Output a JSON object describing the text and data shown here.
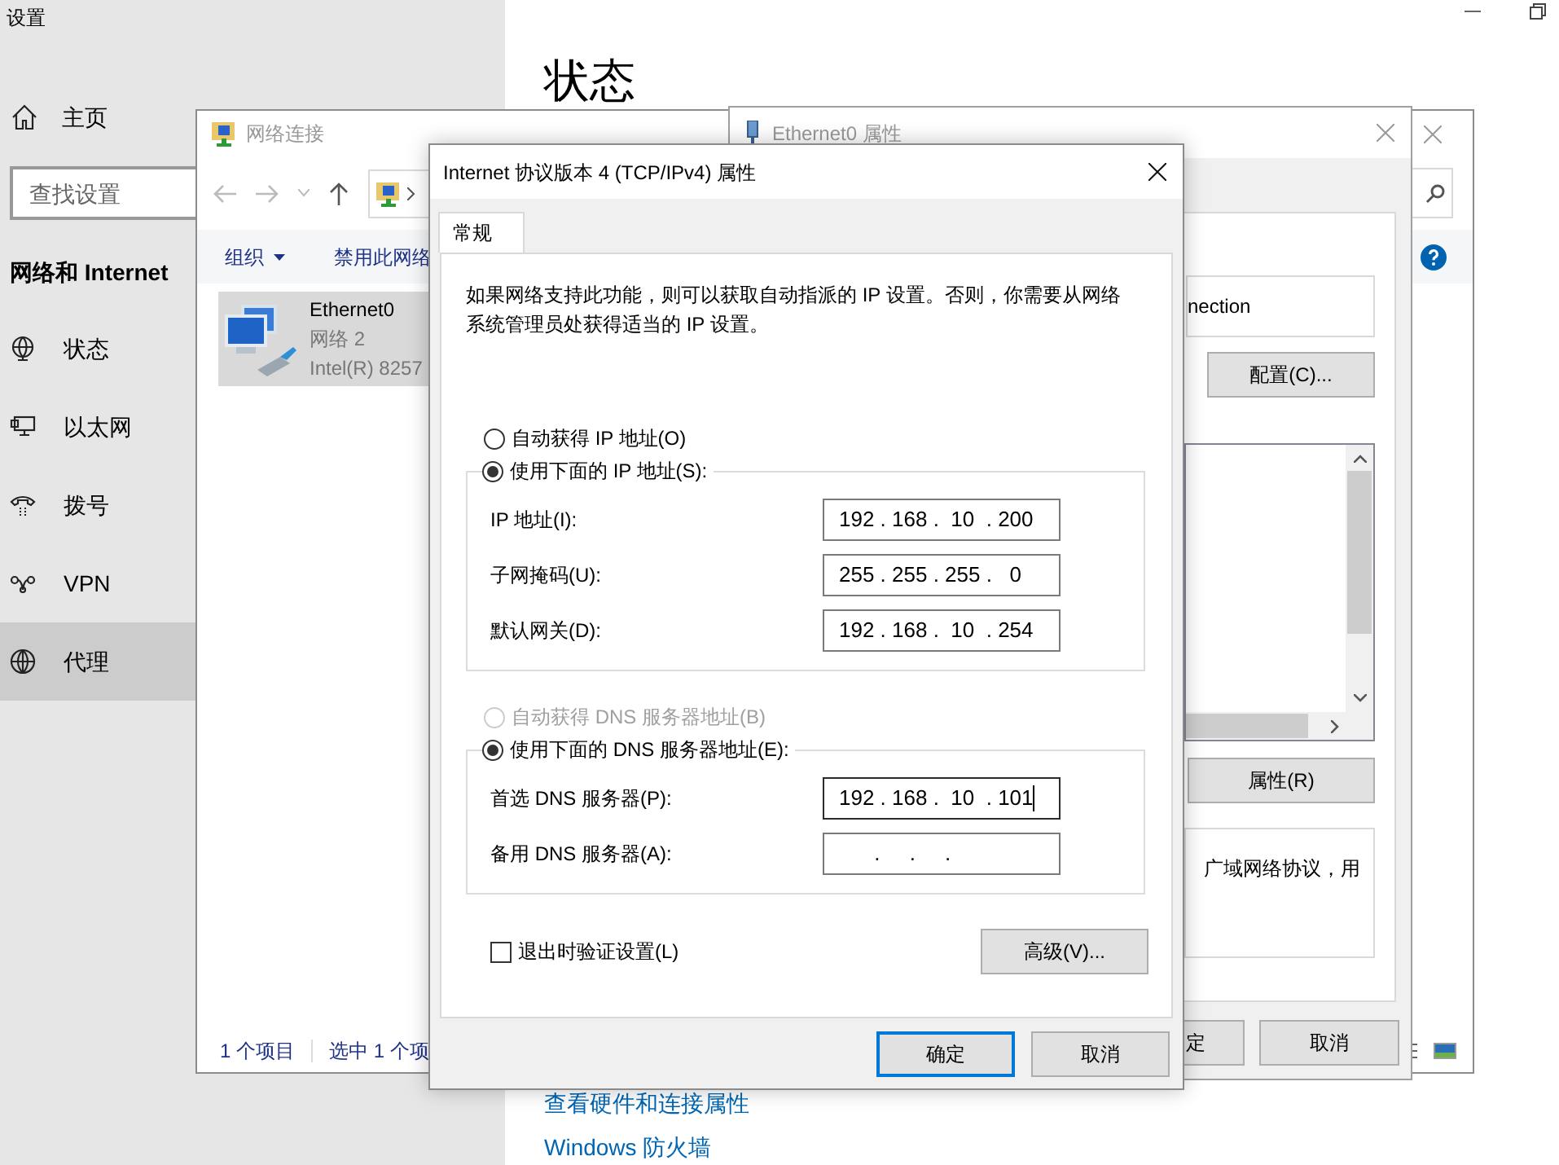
{
  "settings": {
    "title": "设置",
    "heading": "状态",
    "sidebar": {
      "home": "主页",
      "search_placeholder": "查找设置",
      "section": "网络和 Internet",
      "items": [
        {
          "label": "状态",
          "selected": false
        },
        {
          "label": "以太网",
          "selected": false
        },
        {
          "label": "拨号",
          "selected": false
        },
        {
          "label": "VPN",
          "selected": false
        },
        {
          "label": "代理",
          "selected": true
        }
      ]
    },
    "links": [
      "查看硬件和连接属性",
      "Windows 防火墙"
    ]
  },
  "network_window": {
    "title": "网络连接",
    "commands": [
      {
        "label": "组织",
        "dropdown": true
      },
      {
        "label": "禁用此网络",
        "dropdown": false
      }
    ],
    "item": {
      "name": "Ethernet0",
      "network": "网络 2",
      "device": "Intel(R) 8257",
      "selected": true
    },
    "status": [
      "1 个项目",
      "选中 1 个项"
    ]
  },
  "ethernet_window": {
    "title": "Ethernet0 属性",
    "adapter_text": "nection",
    "configure_button": "配置(C)...",
    "properties_button": "属性(R)",
    "description": "广域网络协议，用",
    "buttons": [
      "定",
      "取消"
    ]
  },
  "ipv4_dialog": {
    "title": "Internet 协议版本 4 (TCP/IPv4) 属性",
    "tabs": [
      {
        "label": "常规",
        "selected": true
      }
    ],
    "intro": "如果网络支持此功能，则可以获取自动指派的 IP 设置。否则，你需要从网络系统管理员处获得适当的 IP 设置。",
    "groups": [
      {
        "auto": {
          "label": "自动获得 IP 地址(O)",
          "selected": false,
          "disabled": false
        },
        "manual": {
          "label": "使用下面的 IP 地址(S):",
          "selected": true
        },
        "fields": [
          {
            "label": "IP 地址(I):",
            "value": "192 . 168 .  10  . 200",
            "focused": false
          },
          {
            "label": "子网掩码(U):",
            "value": "255 . 255 . 255 .   0",
            "focused": false
          },
          {
            "label": "默认网关(D):",
            "value": "192 . 168 .  10  . 254",
            "focused": false
          }
        ]
      },
      {
        "auto": {
          "label": "自动获得 DNS 服务器地址(B)",
          "selected": false,
          "disabled": true
        },
        "manual": {
          "label": "使用下面的 DNS 服务器地址(E):",
          "selected": true
        },
        "fields": [
          {
            "label": "首选 DNS 服务器(P):",
            "value": "192 . 168 .  10  . 101",
            "focused": true
          },
          {
            "label": "备用 DNS 服务器(A):",
            "value": "      .     .     .",
            "focused": false
          }
        ]
      }
    ],
    "validate": {
      "label": "退出时验证设置(L)",
      "checked": false
    },
    "advanced_button": "高级(V)...",
    "buttons": [
      {
        "label": "确定",
        "default": true
      },
      {
        "label": "取消",
        "default": false
      }
    ]
  }
}
